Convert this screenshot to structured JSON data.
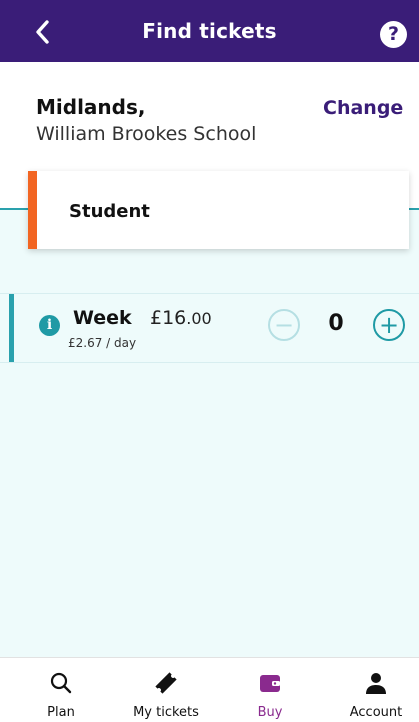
{
  "header": {
    "title": "Find tickets",
    "help_label": "?"
  },
  "region": {
    "name": "Midlands,",
    "school": "William Brookes School",
    "change_label": "Change"
  },
  "passenger": {
    "type": "Student"
  },
  "ticket": {
    "name": "Week",
    "price_main": "£16",
    "price_pence": ".00",
    "per_day": "£2.67 / day",
    "quantity": "0",
    "minus_label": "−",
    "plus_label": "+",
    "info_label": "i"
  },
  "nav": {
    "items": [
      {
        "label": "Plan",
        "icon": "search-icon"
      },
      {
        "label": "My tickets",
        "icon": "ticket-icon"
      },
      {
        "label": "Buy",
        "icon": "wallet-icon"
      },
      {
        "label": "Account",
        "icon": "person-icon"
      }
    ]
  },
  "colors": {
    "header": "#3a1d78",
    "accent_teal": "#2aa1ad",
    "accent_orange": "#f26522",
    "active_nav": "#8a2a8e"
  }
}
